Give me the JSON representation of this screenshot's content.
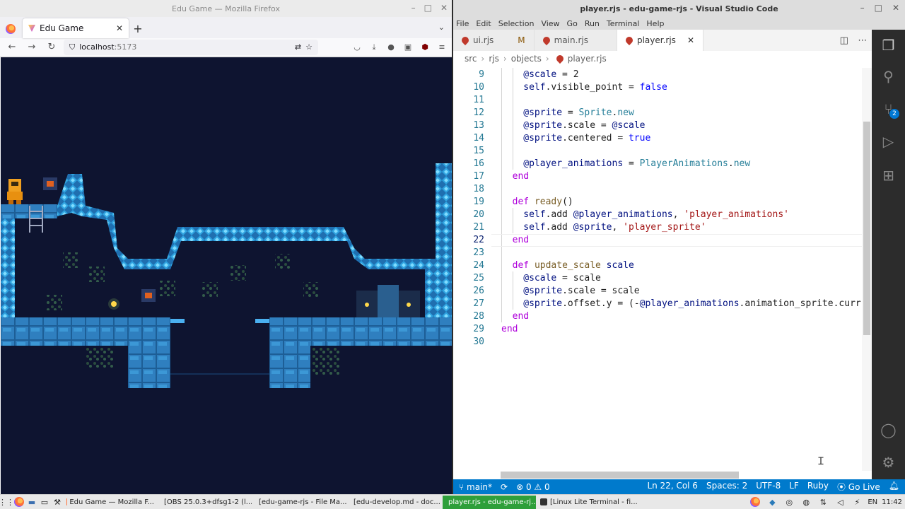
{
  "firefox": {
    "window_title": "Edu Game — Mozilla Firefox",
    "tab_title": "Edu Game",
    "url_host": "localhost",
    "url_port": ":5173"
  },
  "vscode": {
    "window_title": "player.rjs - edu-game-rjs - Visual Studio Code",
    "menu": [
      "File",
      "Edit",
      "Selection",
      "View",
      "Go",
      "Run",
      "Terminal",
      "Help"
    ],
    "tabs": [
      {
        "label": "ui.rjs",
        "modified": "M",
        "active": false
      },
      {
        "label": "main.rjs",
        "modified": "",
        "active": false
      },
      {
        "label": "player.rjs",
        "modified": "",
        "active": true
      }
    ],
    "breadcrumb": [
      "src",
      "rjs",
      "objects",
      "player.rjs"
    ],
    "source_control_badge": "2",
    "code": [
      {
        "n": "9",
        "t": [
          [
            "@scale",
            "iv"
          ],
          [
            " = ",
            ""
          ],
          [
            "2",
            ""
          ]
        ]
      },
      {
        "n": "10",
        "t": [
          [
            "self",
            "sf"
          ],
          [
            ".visible_point = ",
            ""
          ],
          [
            "false",
            "bl"
          ]
        ]
      },
      {
        "n": "11",
        "t": []
      },
      {
        "n": "12",
        "t": [
          [
            "@sprite",
            "iv"
          ],
          [
            " = ",
            ""
          ],
          [
            "Sprite",
            "ty"
          ],
          [
            ".",
            ""
          ],
          [
            "new",
            "ty"
          ]
        ]
      },
      {
        "n": "13",
        "t": [
          [
            "@sprite",
            "iv"
          ],
          [
            ".scale = ",
            ""
          ],
          [
            "@scale",
            "iv"
          ]
        ]
      },
      {
        "n": "14",
        "t": [
          [
            "@sprite",
            "iv"
          ],
          [
            ".centered = ",
            ""
          ],
          [
            "true",
            "bl"
          ]
        ]
      },
      {
        "n": "15",
        "t": []
      },
      {
        "n": "16",
        "t": [
          [
            "@player_animations",
            "iv"
          ],
          [
            " = ",
            ""
          ],
          [
            "PlayerAnimations",
            "ty"
          ],
          [
            ".",
            ""
          ],
          [
            "new",
            "ty"
          ]
        ]
      },
      {
        "n": "17",
        "t": [
          [
            "end",
            "kw"
          ]
        ]
      },
      {
        "n": "18",
        "t": []
      },
      {
        "n": "19",
        "t": [
          [
            "def ",
            "kw"
          ],
          [
            "ready",
            "fn"
          ],
          [
            "()",
            ""
          ]
        ]
      },
      {
        "n": "20",
        "t": [
          [
            "self",
            "sf"
          ],
          [
            ".add ",
            ""
          ],
          [
            "@player_animations",
            "iv"
          ],
          [
            ", ",
            ""
          ],
          [
            "'player_animations'",
            "st"
          ]
        ]
      },
      {
        "n": "21",
        "t": [
          [
            "self",
            "sf"
          ],
          [
            ".add ",
            ""
          ],
          [
            "@sprite",
            "iv"
          ],
          [
            ", ",
            ""
          ],
          [
            "'player_sprite'",
            "st"
          ]
        ]
      },
      {
        "n": "22",
        "t": [
          [
            "end",
            "kw"
          ]
        ]
      },
      {
        "n": "23",
        "t": []
      },
      {
        "n": "24",
        "t": [
          [
            "def ",
            "kw"
          ],
          [
            "update_scale",
            "fn"
          ],
          [
            " scale",
            "iv"
          ]
        ]
      },
      {
        "n": "25",
        "t": [
          [
            "@scale",
            "iv"
          ],
          [
            " = scale",
            ""
          ]
        ]
      },
      {
        "n": "26",
        "t": [
          [
            "@sprite",
            "iv"
          ],
          [
            ".scale = scale",
            ""
          ]
        ]
      },
      {
        "n": "27",
        "t": [
          [
            "@sprite",
            "iv"
          ],
          [
            ".offset.y = (-",
            ""
          ],
          [
            "@player_animations",
            "iv"
          ],
          [
            ".animation_sprite.curr",
            ""
          ]
        ]
      },
      {
        "n": "28",
        "t": [
          [
            "end",
            "kw"
          ]
        ]
      },
      {
        "n": "29",
        "t": [
          [
            "end",
            "kw"
          ]
        ]
      },
      {
        "n": "30",
        "t": []
      }
    ],
    "status": {
      "branch": "main*",
      "problems": "0",
      "warnings": "0",
      "position": "Ln 22, Col 6",
      "spaces": "Spaces: 2",
      "encoding": "UTF-8",
      "eol": "LF",
      "language": "Ruby",
      "golive": "Go Live"
    }
  },
  "taskbar": {
    "tasks": [
      {
        "label": "Edu Game — Mozilla F...",
        "active": false,
        "color": "#ff7139"
      },
      {
        "label": "[OBS 25.0.3+dfsg1-2 (l...",
        "active": false,
        "color": "#333333"
      },
      {
        "label": "[edu-game-rjs - File Ma...",
        "active": false,
        "color": "#2b7bb9"
      },
      {
        "label": "[edu-develop.md - doc...",
        "active": false,
        "color": "#2b7bb9"
      },
      {
        "label": "player.rjs - edu-game-rj...",
        "active": true,
        "color": "#2b7bb9"
      },
      {
        "label": "[Linux Lite Terminal - fi...",
        "active": false,
        "color": "#333333"
      }
    ],
    "keyboard": "EN",
    "clock": "11:42"
  }
}
